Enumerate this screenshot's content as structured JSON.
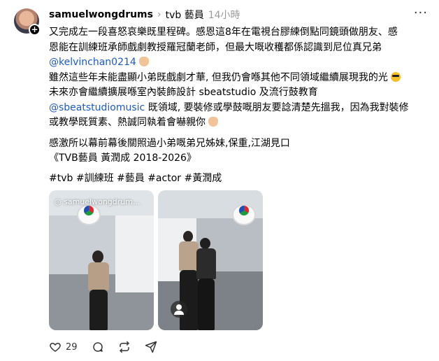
{
  "post": {
    "username": "samuelwongdrums",
    "community": "tvb 藝員",
    "time": "14小時",
    "more_label": "···",
    "lines": [
      "又完成左一段喜怒哀樂既里程碑。感恩這8年在電視台膠練倒點同鏡頭做朋友、感",
      "恩能在訓練班承師戲劇教授羅冠蘭老師，但最大嘅收穫都係認識到尼位真兄弟"
    ],
    "mention1": "@kelvinchan0214",
    "lines2": [
      "雖然這些年未能盡顯小弟既戲劇才華, 但我仍會喺其他不同領域繼續展現我的光",
      "未來亦會繼續擴展喺室內裝飾設計 sbeatstudio 及流行鼓教育"
    ],
    "mention2": "@sbeatstudiomusic",
    "line3_rest": " 既領域, 要裝修或學鼓嘅朋友要諗清楚先搵我，因為我對裝修",
    "line4": "或教學既質素、熱誠同執着會嚇親你",
    "line5": "感激所以幕前幕後關照過小弟嘅弟兄姊妹,保重,江湖見口",
    "line6": "《TVB藝員 黃潤成 2018-2026》",
    "hashtags": "#tvb #訓練班 #藝員 #actor #黃潤成",
    "photo_watermark": "samuelwongdrum...",
    "likes": "29"
  },
  "icons": {
    "plus": "+",
    "chevron": "›"
  }
}
